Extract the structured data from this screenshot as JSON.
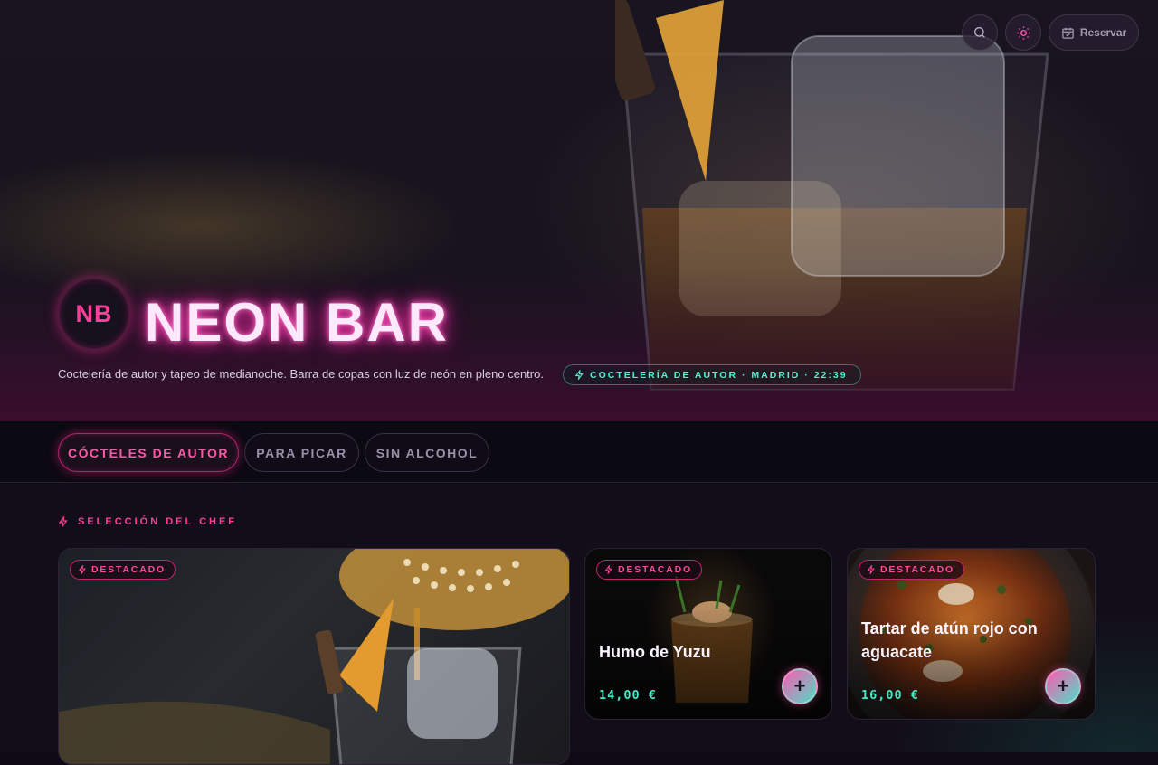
{
  "header": {
    "search_icon": "search-icon",
    "theme_icon": "sun-icon",
    "reserve_label": "Reservar",
    "reserve_icon": "calendar-icon"
  },
  "hero": {
    "logo_initials": "NB",
    "brand_name": "NEON BAR",
    "tagline": "Coctelería de autor y tapeo de medianoche. Barra de copas con luz de neón en pleno centro.",
    "chip": "COCTELERÍA DE AUTOR · MADRID · 22:39",
    "chip_icon": "bolt-icon"
  },
  "tabs": [
    {
      "label": "CÓCTELES DE AUTOR",
      "active": true
    },
    {
      "label": "PARA PICAR",
      "active": false
    },
    {
      "label": "SIN ALCOHOL",
      "active": false
    }
  ],
  "section": {
    "title": "SELECCIÓN DEL CHEF"
  },
  "cards": [
    {
      "badge": "DESTACADO",
      "name": "",
      "price": ""
    },
    {
      "badge": "DESTACADO",
      "name": "Humo de Yuzu",
      "price": "14,00 €",
      "add": "+"
    },
    {
      "badge": "DESTACADO",
      "name": "Tartar de atún rojo con aguacate",
      "price": "16,00 €",
      "add": "+"
    }
  ],
  "colors": {
    "accent_pink": "#ff3e9a",
    "accent_teal": "#46ecc6",
    "background": "#120e19"
  }
}
